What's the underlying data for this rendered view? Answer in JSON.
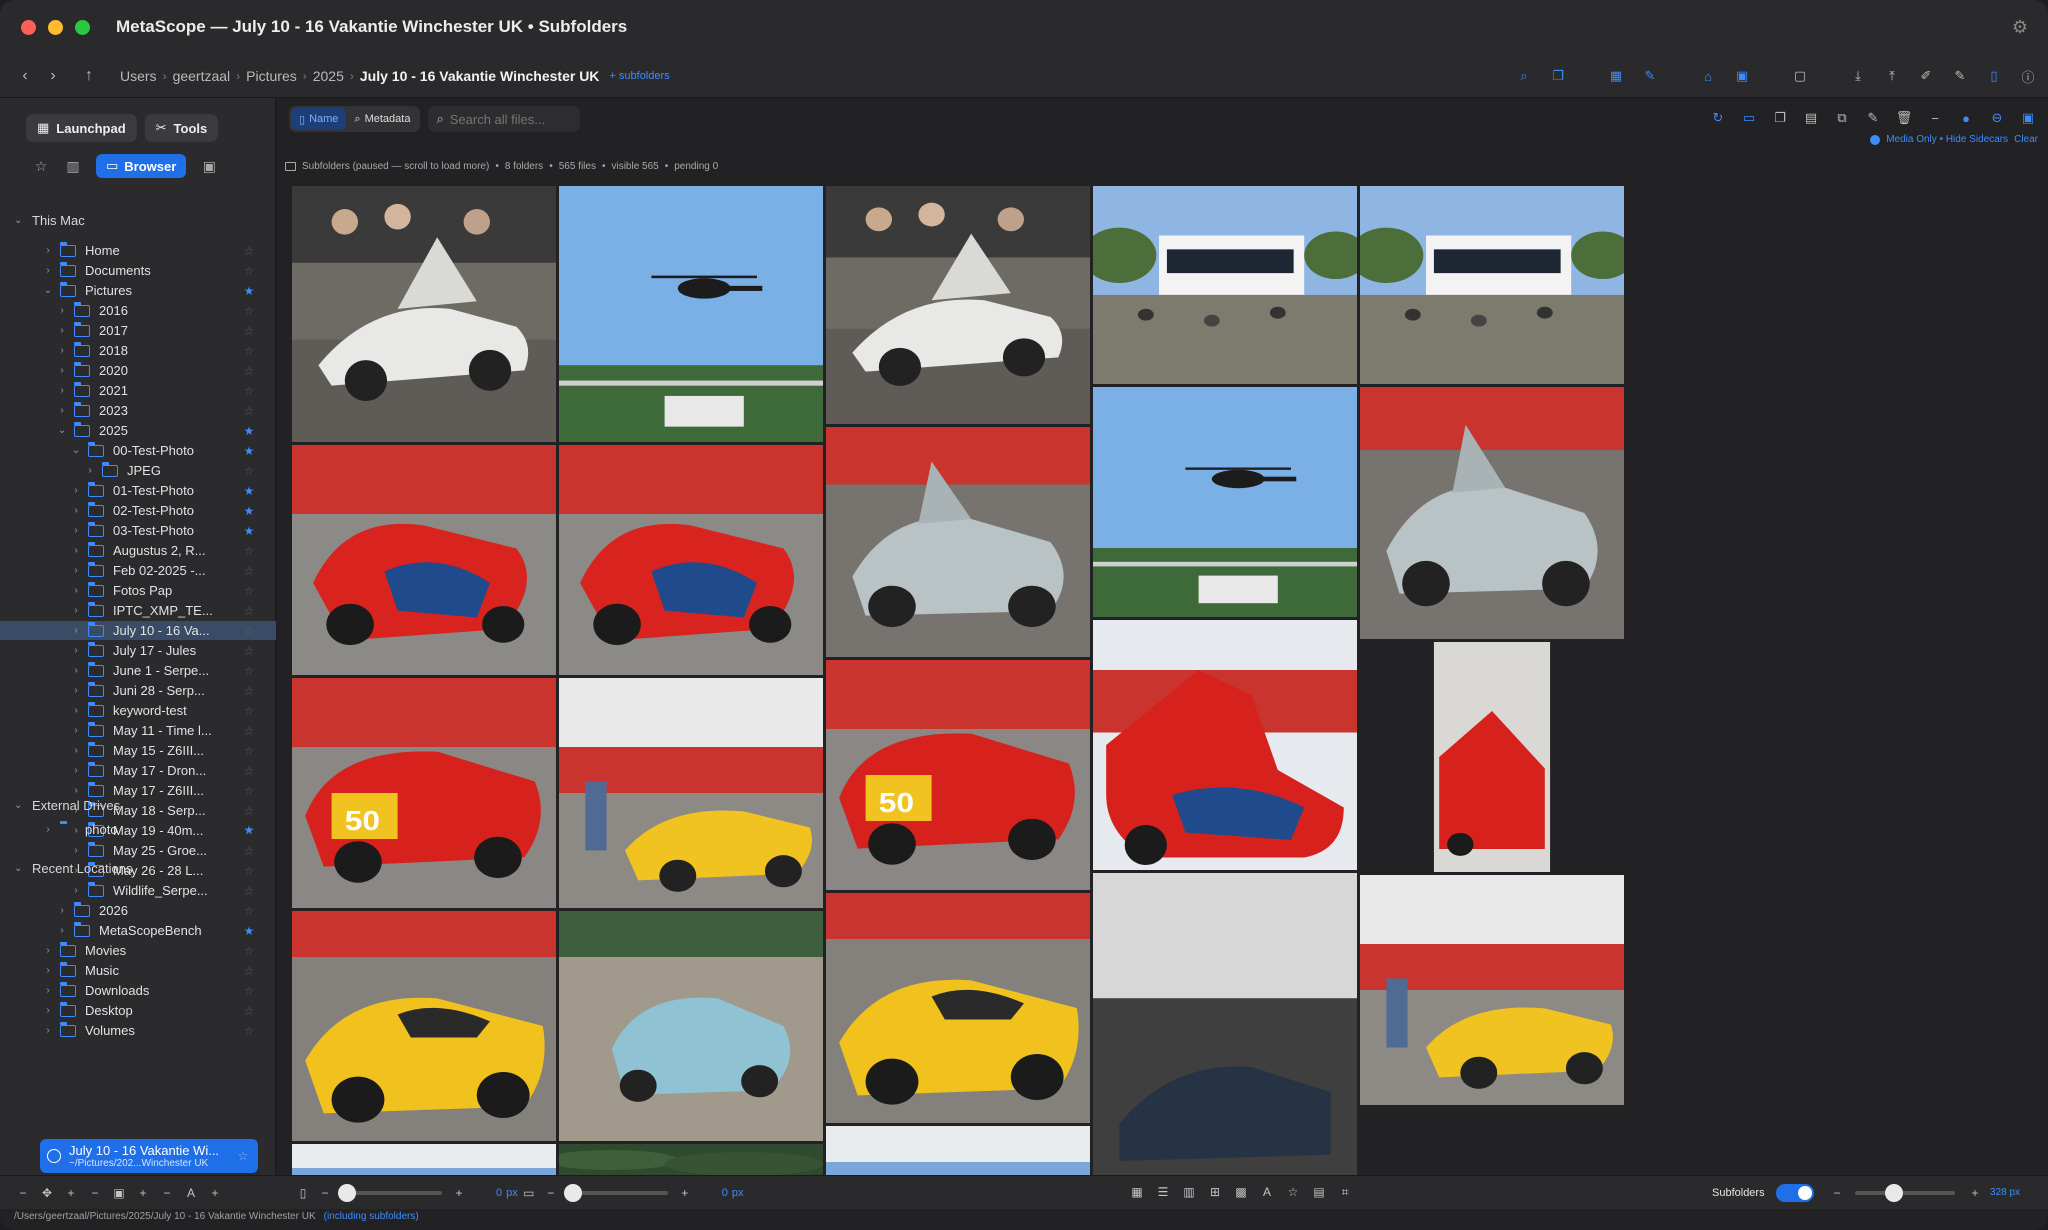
{
  "window": {
    "title": "MetaScope — July 10 - 16 Vakantie Winchester UK • Subfolders"
  },
  "breadcrumb": {
    "items": [
      "Users",
      "geertzaal",
      "Pictures",
      "2025",
      "July 10 - 16 Vakantie Winchester UK"
    ],
    "badge": "+ subfolders"
  },
  "sidebar": {
    "launchpad_label": "Launchpad",
    "tools_label": "Tools",
    "browser_label": "Browser",
    "sections": {
      "this_mac": "This Mac",
      "external": "External Drives",
      "recent": "Recent Locations"
    },
    "tree": [
      {
        "label": "Home",
        "depth": 1,
        "chev": "closed",
        "star": false,
        "icon": "home-folder-icon"
      },
      {
        "label": "Documents",
        "depth": 1,
        "chev": "closed",
        "star": false,
        "icon": "folder-icon"
      },
      {
        "label": "Pictures",
        "depth": 1,
        "chev": "open",
        "star": true,
        "icon": "folder-icon"
      },
      {
        "label": "2016",
        "depth": 2,
        "chev": "closed",
        "star": false,
        "icon": "folder-icon"
      },
      {
        "label": "2017",
        "depth": 2,
        "chev": "closed",
        "star": false,
        "icon": "folder-icon"
      },
      {
        "label": "2018",
        "depth": 2,
        "chev": "closed",
        "star": false,
        "icon": "folder-icon"
      },
      {
        "label": "2020",
        "depth": 2,
        "chev": "closed",
        "star": false,
        "icon": "folder-icon"
      },
      {
        "label": "2021",
        "depth": 2,
        "chev": "closed",
        "star": false,
        "icon": "folder-icon"
      },
      {
        "label": "2023",
        "depth": 2,
        "chev": "closed",
        "star": false,
        "icon": "folder-icon"
      },
      {
        "label": "2025",
        "depth": 2,
        "chev": "open",
        "star": true,
        "icon": "folder-icon"
      },
      {
        "label": "00-Test-Photo",
        "depth": 3,
        "chev": "open",
        "star": true,
        "icon": "folder-icon"
      },
      {
        "label": "JPEG",
        "depth": 4,
        "chev": "closed",
        "star": false,
        "icon": "folder-icon"
      },
      {
        "label": "01-Test-Photo",
        "depth": 3,
        "chev": "closed",
        "star": true,
        "icon": "folder-icon"
      },
      {
        "label": "02-Test-Photo",
        "depth": 3,
        "chev": "closed",
        "star": true,
        "icon": "folder-icon"
      },
      {
        "label": "03-Test-Photo",
        "depth": 3,
        "chev": "closed",
        "star": true,
        "icon": "folder-icon"
      },
      {
        "label": "Augustus 2, R...",
        "depth": 3,
        "chev": "closed",
        "star": false,
        "icon": "folder-icon"
      },
      {
        "label": "Feb 02-2025 -...",
        "depth": 3,
        "chev": "closed",
        "star": false,
        "icon": "folder-icon"
      },
      {
        "label": "Fotos Pap",
        "depth": 3,
        "chev": "closed",
        "star": false,
        "icon": "folder-icon"
      },
      {
        "label": "IPTC_XMP_TE...",
        "depth": 3,
        "chev": "closed",
        "star": false,
        "icon": "folder-icon"
      },
      {
        "label": "July 10 - 16 Va...",
        "depth": 3,
        "chev": "closed",
        "star": false,
        "icon": "folder-icon",
        "selected": true
      },
      {
        "label": "July 17 - Jules",
        "depth": 3,
        "chev": "closed",
        "star": false,
        "icon": "folder-icon"
      },
      {
        "label": "June 1 - Serpe...",
        "depth": 3,
        "chev": "closed",
        "star": false,
        "icon": "folder-icon"
      },
      {
        "label": "Juni 28 - Serp...",
        "depth": 3,
        "chev": "closed",
        "star": false,
        "icon": "folder-icon"
      },
      {
        "label": "keyword-test",
        "depth": 3,
        "chev": "closed",
        "star": false,
        "icon": "folder-icon"
      },
      {
        "label": "May 11 - Time l...",
        "depth": 3,
        "chev": "closed",
        "star": false,
        "icon": "folder-icon"
      },
      {
        "label": "May 15 - Z6III...",
        "depth": 3,
        "chev": "closed",
        "star": false,
        "icon": "folder-icon"
      },
      {
        "label": "May 17 - Dron...",
        "depth": 3,
        "chev": "closed",
        "star": false,
        "icon": "folder-icon"
      },
      {
        "label": "May 17 - Z6III...",
        "depth": 3,
        "chev": "closed",
        "star": false,
        "icon": "folder-icon"
      },
      {
        "label": "May 18 - Serp...",
        "depth": 3,
        "chev": "closed",
        "star": false,
        "icon": "folder-icon"
      },
      {
        "label": "May 19 - 40m...",
        "depth": 3,
        "chev": "closed",
        "star": false,
        "icon": "folder-icon"
      },
      {
        "label": "May 25 - Groe...",
        "depth": 3,
        "chev": "closed",
        "star": false,
        "icon": "folder-icon"
      },
      {
        "label": "May 26 - 28 L...",
        "depth": 3,
        "chev": "closed",
        "star": false,
        "icon": "folder-icon"
      },
      {
        "label": "Wildlife_Serpe...",
        "depth": 3,
        "chev": "closed",
        "star": false,
        "icon": "folder-icon"
      },
      {
        "label": "2026",
        "depth": 2,
        "chev": "closed",
        "star": false,
        "icon": "folder-icon"
      },
      {
        "label": "MetaScopeBench",
        "depth": 2,
        "chev": "closed",
        "star": true,
        "icon": "folder-icon"
      },
      {
        "label": "Movies",
        "depth": 1,
        "chev": "closed",
        "star": false,
        "icon": "folder-icon"
      },
      {
        "label": "Music",
        "depth": 1,
        "chev": "closed",
        "star": false,
        "icon": "folder-icon"
      },
      {
        "label": "Downloads",
        "depth": 1,
        "chev": "closed",
        "star": false,
        "icon": "folder-icon"
      },
      {
        "label": "Desktop",
        "depth": 1,
        "chev": "closed",
        "star": false,
        "icon": "folder-icon"
      },
      {
        "label": "Volumes",
        "depth": 1,
        "chev": "closed",
        "star": false,
        "icon": "folder-icon"
      }
    ],
    "external": [
      {
        "label": "photo",
        "star": true
      }
    ],
    "recent": {
      "title": "July 10 - 16 Vakantie Wi...",
      "path": "~/Pictures/202...Winchester UK"
    }
  },
  "toolbar": {
    "name_label": "Name",
    "metadata_label": "Metadata",
    "search_placeholder": "Search all files...",
    "media_only_label": "Media Only • Hide Sidecars",
    "clear_label": "Clear"
  },
  "status": {
    "text": "Subfolders (paused — scroll to load more)",
    "folders": "8 folders",
    "files": "565 files",
    "visible": "visible 565",
    "pending": "pending 0"
  },
  "bottom": {
    "zoom_a_value": "0",
    "zoom_a_unit": "px",
    "zoom_b_value": "0",
    "zoom_b_unit": "px",
    "subfolders_label": "Subfolders",
    "subfolders_on": true,
    "size_value": "328 px"
  },
  "footer": {
    "path": "/Users/geertzaal/Pictures/2025/July 10 - 16 Vakantie Winchester UK",
    "including": "(including subfolders)"
  },
  "photos": [
    {
      "subject": "white-supercar-gullwing"
    },
    {
      "subject": "helicopter-sky"
    },
    {
      "subject": "white-supercar-gullwing"
    },
    {
      "subject": "building-crowd"
    },
    {
      "subject": "building-crowd"
    },
    {
      "subject": "red-ferrari"
    },
    {
      "subject": "red-ferrari"
    },
    {
      "subject": "silver-pagani"
    },
    {
      "subject": "helicopter-sky"
    },
    {
      "subject": "silver-pagani"
    },
    {
      "subject": "red-ferrari-50"
    },
    {
      "subject": "yellow-ferrari-paddock"
    },
    {
      "subject": "red-ferrari-50"
    },
    {
      "subject": "red-ferrari-open"
    },
    {
      "subject": "red-ferrari-portrait"
    },
    {
      "subject": "yellow-ferrari"
    },
    {
      "subject": "blue-supercar"
    },
    {
      "subject": "yellow-ferrari"
    },
    {
      "subject": "yellow-ferrari-paddock"
    },
    {
      "subject": "sky-tent"
    },
    {
      "subject": "trees"
    },
    {
      "subject": "sky-tent"
    },
    {
      "subject": "car-dark"
    }
  ],
  "colors": {
    "accent": "#1f6fe8",
    "link": "#3d8bff",
    "window_bg": "#222224",
    "sidebar_bg": "#2b2b2e"
  }
}
